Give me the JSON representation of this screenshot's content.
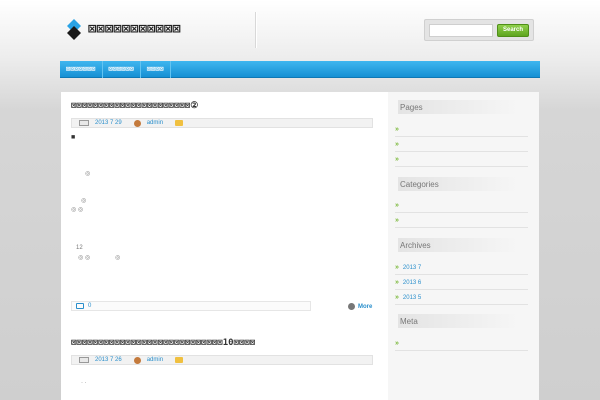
{
  "site": {
    "title": "⊠⊠⊠⊠⊠⊠⊠⊠⊠⊠⊠"
  },
  "search": {
    "placeholder": "",
    "button_label": "Search"
  },
  "nav": {
    "items": [
      {
        "label": "⊠⊠⊠⊠⊠⊠⊠"
      },
      {
        "label": "⊠⊠⊠⊠⊠⊠"
      },
      {
        "label": "⊠⊠⊠⊠"
      }
    ]
  },
  "posts": [
    {
      "title": "⊠⊠⊠⊠⊠⊠⊠⊠⊠⊠⊠⊠⊠⊠⊠⊠⊠⊠⊠⊠⊠⊠②",
      "date": "2013 7 29",
      "author": "admin",
      "body_glyphs": [
        "■",
        "◎",
        "◎",
        "◎ ◎",
        "12",
        "◎ ◎",
        "◎"
      ],
      "comments": "0",
      "more": "More"
    },
    {
      "title": "⊠⊠⊠⊠⊠⊠⊠⊠⊠⊠⊠⊠⊠⊠⊠⊠⊠⊠⊠⊠⊠⊠⊠⊠⊠⊠⊠⊠10⊠⊠⊠⊠",
      "date": "2013 7 26",
      "author": "admin",
      "body_glyphs": [
        "·  ·"
      ]
    }
  ],
  "sidebar": {
    "pages": {
      "title": "Pages",
      "items": [
        "",
        "",
        ""
      ]
    },
    "categories": {
      "title": "Categories",
      "items": [
        "",
        ""
      ]
    },
    "archives": {
      "title": "Archives",
      "items": [
        "2013 7",
        "2013 6",
        "2013 5"
      ]
    },
    "meta": {
      "title": "Meta",
      "items": [
        ""
      ]
    }
  },
  "colors": {
    "nav": "#1f9fe0",
    "link": "#2a8fcc",
    "search_button": "#6cb52a",
    "bullet": "#7ab83a"
  }
}
